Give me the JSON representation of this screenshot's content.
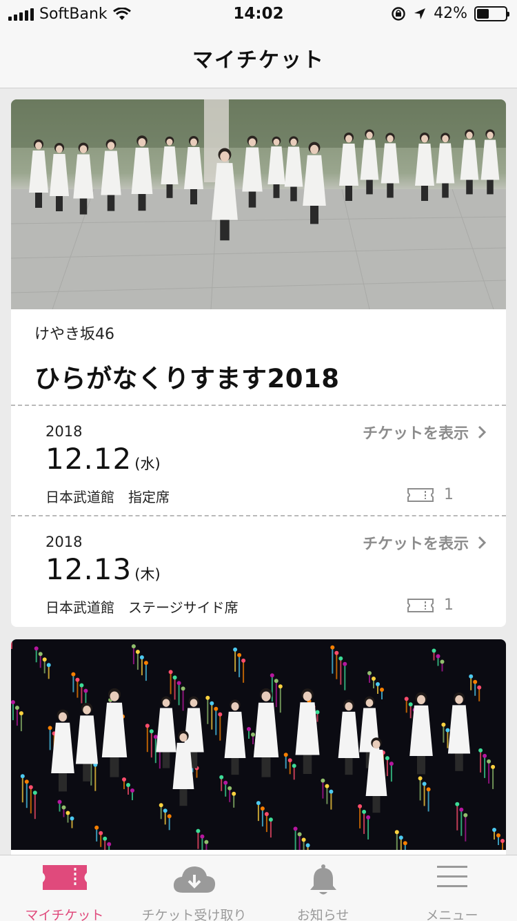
{
  "status_bar": {
    "carrier": "SoftBank",
    "time": "14:02",
    "battery": "42%",
    "battery_level": 0.42
  },
  "nav": {
    "title": "マイチケット"
  },
  "cards": [
    {
      "photo_icon": "group-photo-outdoor",
      "artist": "けやき坂46",
      "title": "ひらがなくりすます2018",
      "dates": [
        {
          "year": "2018",
          "date": "12.12",
          "weekday": "(水)",
          "venue": "日本武道館　指定席",
          "action": "チケットを表示",
          "count": "1"
        },
        {
          "year": "2018",
          "date": "12.13",
          "weekday": "(木)",
          "venue": "日本武道館　ステージサイド席",
          "action": "チケットを表示",
          "count": "1"
        }
      ]
    },
    {
      "photo_icon": "group-photo-colorful-lights"
    }
  ],
  "tabs": [
    {
      "label": "マイチケット",
      "icon": "ticket-icon",
      "active": true
    },
    {
      "label": "チケット受け取り",
      "icon": "cloud-download-icon",
      "active": false
    },
    {
      "label": "お知らせ",
      "icon": "bell-icon",
      "active": false
    },
    {
      "label": "メニュー",
      "icon": "menu-icon",
      "active": false
    }
  ],
  "colors": {
    "accent": "#e04a7c",
    "inactive": "#9a9a9a",
    "background": "#ebebeb",
    "card": "#ffffff"
  }
}
